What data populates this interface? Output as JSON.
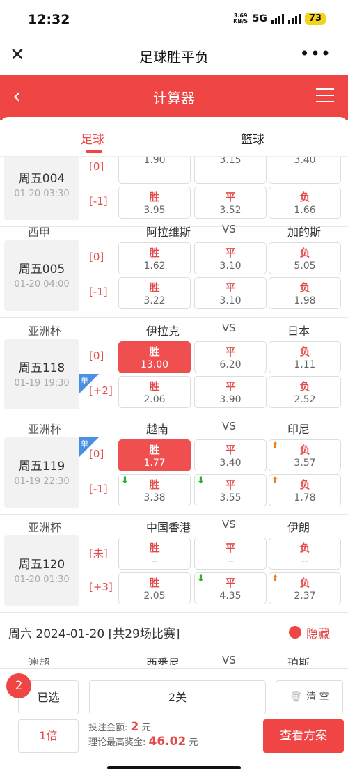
{
  "status": {
    "time": "12:32",
    "speed": "3.69 KB/S",
    "network": "5G",
    "battery": "73"
  },
  "titlebar": {
    "title": "足球胜平负",
    "close_icon": "close-icon",
    "more_icon": "more-icon"
  },
  "header": {
    "title": "计算器",
    "back_icon": "back-arrow-icon",
    "menu_icon": "menu-icon",
    "color": "#f04545"
  },
  "tabs": [
    {
      "label": "足球",
      "active": true
    },
    {
      "label": "篮球",
      "active": false
    }
  ],
  "matches": [
    {
      "league": "",
      "home": "",
      "vs": "",
      "away": "",
      "no": "周五004",
      "time": "01-20 03:30",
      "rows": [
        {
          "hc": "[0]",
          "cells": [
            {
              "k": "",
              "o": "1.90"
            },
            {
              "k": "",
              "o": "3.15"
            },
            {
              "k": "",
              "o": "3.40"
            }
          ]
        },
        {
          "hc": "[-1]",
          "cells": [
            {
              "k": "胜",
              "o": "3.95"
            },
            {
              "k": "平",
              "o": "3.52"
            },
            {
              "k": "负",
              "o": "1.66"
            }
          ]
        }
      ]
    },
    {
      "league": "西甲",
      "home": "阿拉维斯",
      "vs": "VS",
      "away": "加的斯",
      "no": "周五005",
      "time": "01-20 04:00",
      "rows": [
        {
          "hc": "[0]",
          "cells": [
            {
              "k": "胜",
              "o": "1.62"
            },
            {
              "k": "平",
              "o": "3.10"
            },
            {
              "k": "负",
              "o": "5.05"
            }
          ]
        },
        {
          "hc": "[-1]",
          "cells": [
            {
              "k": "胜",
              "o": "3.22"
            },
            {
              "k": "平",
              "o": "3.10"
            },
            {
              "k": "负",
              "o": "1.98"
            }
          ]
        }
      ]
    },
    {
      "league": "亚洲杯",
      "home": "伊拉克",
      "vs": "VS",
      "away": "日本",
      "no": "周五118",
      "time": "01-19 19:30",
      "single": "单",
      "single_row": 1,
      "rows": [
        {
          "hc": "[0]",
          "cells": [
            {
              "k": "胜",
              "o": "13.00",
              "sel": true
            },
            {
              "k": "平",
              "o": "6.20"
            },
            {
              "k": "负",
              "o": "1.11"
            }
          ]
        },
        {
          "hc": "[+2]",
          "cells": [
            {
              "k": "胜",
              "o": "2.06"
            },
            {
              "k": "平",
              "o": "3.90"
            },
            {
              "k": "负",
              "o": "2.52"
            }
          ]
        }
      ]
    },
    {
      "league": "亚洲杯",
      "home": "越南",
      "vs": "VS",
      "away": "印尼",
      "no": "周五119",
      "time": "01-19 22:30",
      "single": "单",
      "single_row": 0,
      "rows": [
        {
          "hc": "[0]",
          "cells": [
            {
              "k": "胜",
              "o": "1.77",
              "sel": true
            },
            {
              "k": "平",
              "o": "3.40"
            },
            {
              "k": "负",
              "o": "3.57",
              "arrow": "up"
            }
          ]
        },
        {
          "hc": "[-1]",
          "cells": [
            {
              "k": "胜",
              "o": "3.38",
              "arrow": "down"
            },
            {
              "k": "平",
              "o": "3.55",
              "arrow": "down"
            },
            {
              "k": "负",
              "o": "1.78",
              "arrow": "up"
            }
          ]
        }
      ]
    },
    {
      "league": "亚洲杯",
      "home": "中国香港",
      "vs": "VS",
      "away": "伊朗",
      "no": "周五120",
      "time": "01-20 01:30",
      "rows": [
        {
          "hc": "[未]",
          "cells": [
            {
              "k": "胜",
              "o": "--",
              "dim": true
            },
            {
              "k": "平",
              "o": "--",
              "dim": true
            },
            {
              "k": "负",
              "o": "--",
              "dim": true
            }
          ]
        },
        {
          "hc": "[+3]",
          "cells": [
            {
              "k": "胜",
              "o": "2.05"
            },
            {
              "k": "平",
              "o": "4.35",
              "arrow": "down"
            },
            {
              "k": "负",
              "o": "2.37",
              "arrow": "up"
            }
          ]
        }
      ]
    }
  ],
  "day": {
    "label": "周六 2024-01-20 [共29场比赛]",
    "hide_label": "隐藏"
  },
  "next_match": {
    "league": "澳超",
    "home": "西悉尼",
    "vs": "VS",
    "away": "珀斯"
  },
  "bottom": {
    "count": "2",
    "selected_label": "已选",
    "pass_label": "2关",
    "clear_label": "清 空",
    "multiple_label": "1倍",
    "stake_label": "投注金额:",
    "stake_value": "2",
    "stake_unit": "元",
    "prize_label": "理论最高奖金:",
    "prize_value": "46.02",
    "prize_unit": "元",
    "view_label": "查看方案"
  },
  "arrows": {
    "up": "⬆",
    "down": "⬇"
  }
}
